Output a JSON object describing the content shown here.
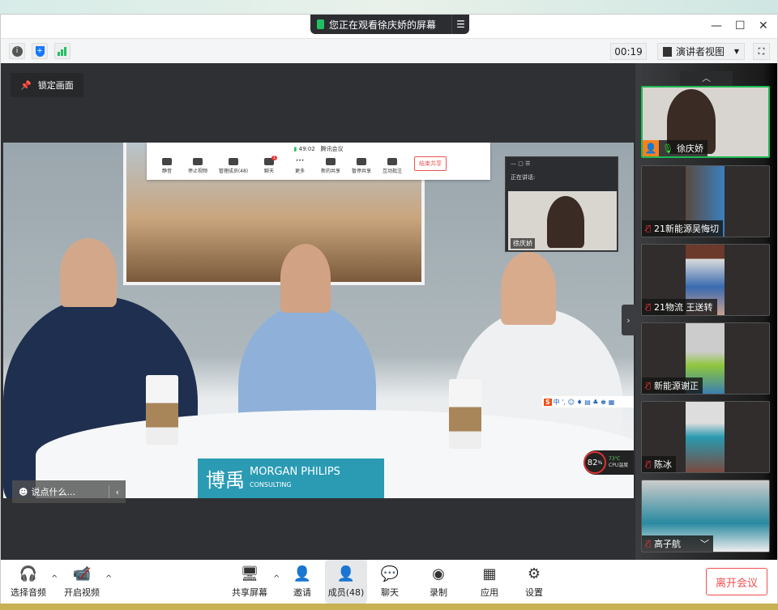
{
  "banner": {
    "text": "您正在观看徐庆娇的屏幕",
    "menu_icon": "list-icon"
  },
  "window_controls": {
    "minimize": "—",
    "maximize": "☐",
    "close": "✕"
  },
  "toolbar": {
    "timer": "00:19",
    "view_mode": "演讲者视图",
    "info_icon": "i",
    "shield_icon": "+",
    "signal_icon": "signal"
  },
  "lock_label": "锁定画面",
  "shared_screen": {
    "meeting_bar": {
      "time": "49:02",
      "app": "腾讯会议",
      "items": [
        "静音",
        "停止视频",
        "管理成员(48)",
        "聊天",
        "更多",
        "新的共享",
        "暂停共享",
        "互动批注"
      ],
      "chat_badge": "1",
      "end": "结束共享"
    },
    "mini_window": {
      "speaking": "正在讲话:",
      "name": "徐庆娇"
    },
    "sign": {
      "cn": "博禹",
      "en1": "MORGAN PHILIPS",
      "en2": "CONSULTING"
    },
    "ime": {
      "logo": "S",
      "text": "中 ', ☺ ♦ ▤ ♣ ♚ ▦"
    },
    "cpu": {
      "percent": "82",
      "unit": "%",
      "temp": "73℃",
      "label": "CPU温度"
    },
    "chat_input": "说点什么...",
    "chat_collapse": "‹"
  },
  "participants": [
    {
      "name": "徐庆娇",
      "mic": "on",
      "active": true
    },
    {
      "name": "21新能源吴悔切",
      "mic": "off"
    },
    {
      "name": "21物流 王送转",
      "mic": "off"
    },
    {
      "name": "新能源谢正",
      "mic": "off"
    },
    {
      "name": "陈冰",
      "mic": "off"
    },
    {
      "name": "高子航",
      "mic": "off"
    }
  ],
  "bottom": {
    "audio": "选择音频",
    "video": "开启视频",
    "share": "共享屏幕",
    "invite": "邀请",
    "members": "成员(48)",
    "chat": "聊天",
    "record": "录制",
    "apps": "应用",
    "settings": "设置",
    "leave": "离开会议"
  },
  "colors": {
    "accent_green": "#1db954",
    "leave_red": "#f05050",
    "avatar_orange": "#f58220"
  }
}
